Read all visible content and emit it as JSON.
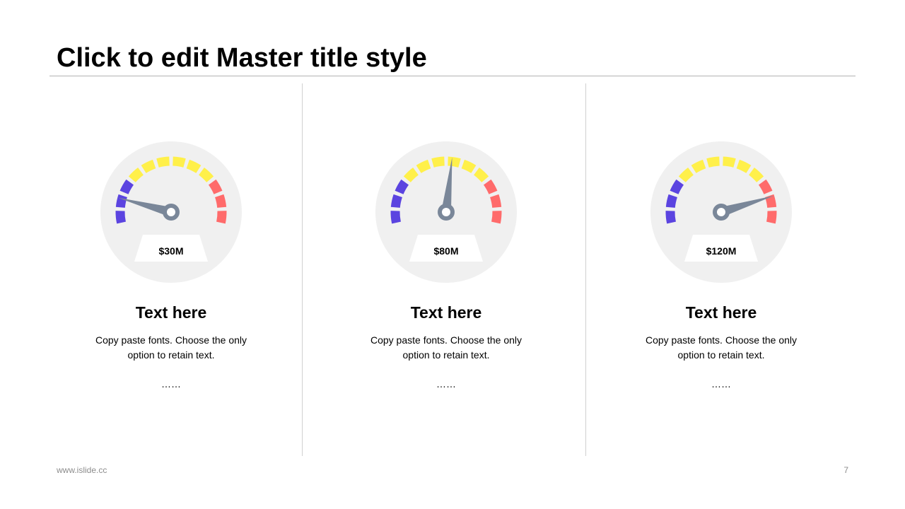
{
  "slide": {
    "title": "Click to edit Master title style",
    "footer_url": "www.islide.cc",
    "page_number": "7"
  },
  "colors": {
    "gauge_background": "#f0f0f0",
    "low": "#5b44e0",
    "mid": "#fff04a",
    "high": "#ff6b6b",
    "needle": "#7a8799",
    "label_bg": "#ffffff"
  },
  "gauges": [
    {
      "value_label": "$30M",
      "level": 0.14,
      "heading": "Text here",
      "body": "Copy paste fonts. Choose the only option to retain text.",
      "ellipsis": "……"
    },
    {
      "value_label": "$80M",
      "level": 0.53,
      "heading": "Text here",
      "body": "Copy paste fonts. Choose the only option to retain text.",
      "ellipsis": "……"
    },
    {
      "value_label": "$120M",
      "level": 0.85,
      "heading": "Text here",
      "body": "Copy paste fonts. Choose the only option to retain text.",
      "ellipsis": "……"
    }
  ]
}
